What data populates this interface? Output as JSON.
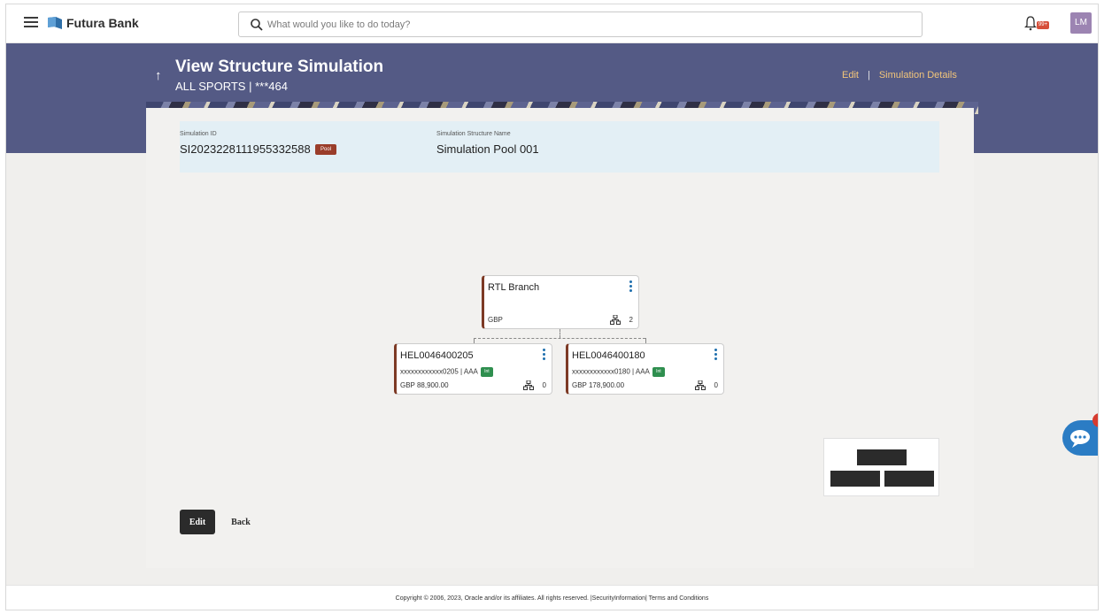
{
  "app": {
    "brand": "Futura Bank",
    "search_placeholder": "What would you like to do today?",
    "notification_badge": "99+",
    "user_initials": "LM"
  },
  "header": {
    "title": "View Structure Simulation",
    "subtitle": "ALL SPORTS | ***464",
    "links": {
      "edit": "Edit",
      "separator": "|",
      "details": "Simulation Details"
    }
  },
  "simulation": {
    "id_label": "Simulation ID",
    "id_value": "SI2023228111955332588",
    "type_badge": "Pool",
    "name_label": "Simulation Structure Name",
    "name_value": "Simulation Pool 001"
  },
  "tree": {
    "root": {
      "name": "RTL Branch",
      "currency": "GBP",
      "child_count": "2"
    },
    "children": [
      {
        "account": "HEL0046400205",
        "masked": "xxxxxxxxxxxx0205 | AAA",
        "badge": "Int",
        "balance": "GBP 88,900.00",
        "child_count": "0"
      },
      {
        "account": "HEL0046400180",
        "masked": "xxxxxxxxxxxx0180 | AAA",
        "badge": "Int",
        "balance": "GBP 178,900.00",
        "child_count": "0"
      }
    ]
  },
  "actions": {
    "edit": "Edit",
    "back": "Back"
  },
  "chat": {
    "badge": "1"
  },
  "footer": {
    "text": "Copyright © 2006, 2023, Oracle and/or its affiliates. All rights reserved. |SecurityInformation| Terms and Conditions"
  },
  "colors": {
    "banner": "#545a85",
    "accent_link": "#f2c57a",
    "node_border": "#7d3a25",
    "pool_badge": "#9a3d2a",
    "int_badge": "#2f8f4f",
    "chat": "#2b7cc4"
  }
}
